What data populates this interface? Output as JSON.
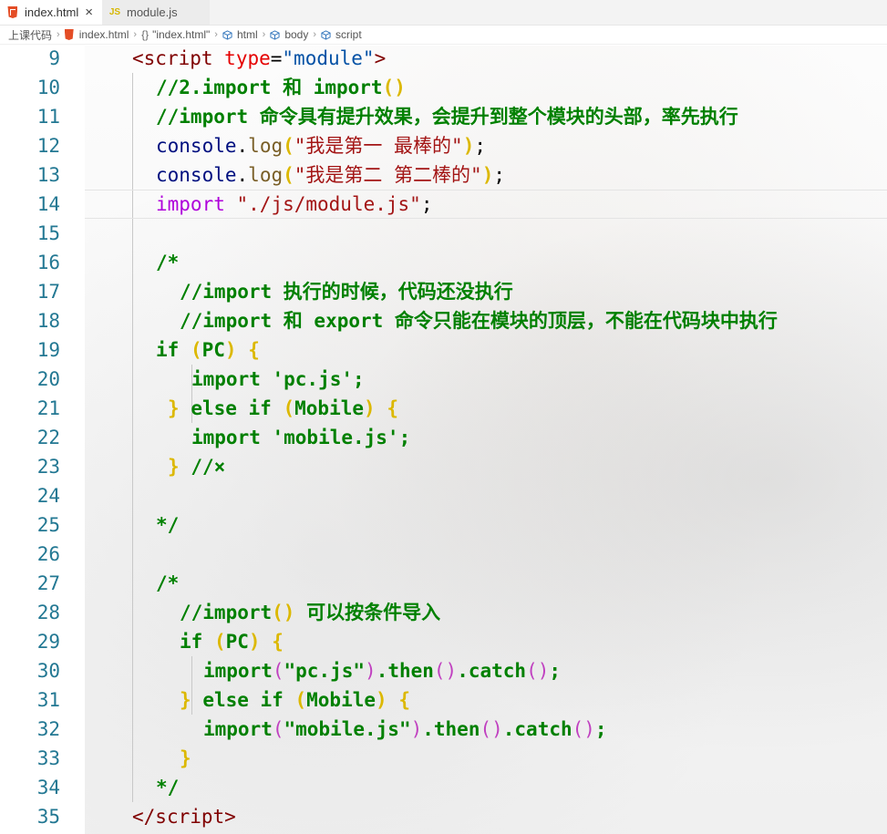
{
  "tabs": [
    {
      "label": "index.html",
      "active": true,
      "icon": "html5-icon"
    },
    {
      "label": "module.js",
      "active": false,
      "icon": "js-icon"
    }
  ],
  "breadcrumb": {
    "folder": "上课代码",
    "file": "index.html",
    "element": "\"index.html\"",
    "html": "html",
    "body": "body",
    "script": "script"
  },
  "editor": {
    "line_numbers": [
      "9",
      "10",
      "11",
      "12",
      "13",
      "14",
      "15",
      "16",
      "17",
      "18",
      "19",
      "20",
      "21",
      "22",
      "23",
      "24",
      "25",
      "26",
      "27",
      "28",
      "29",
      "30",
      "31",
      "32",
      "33",
      "34",
      "35"
    ],
    "current_line": "14",
    "code": {
      "l9": {
        "open": "<",
        "tag": "script",
        "attr": "type",
        "eq": "=",
        "val": "\"module\"",
        "close": ">"
      },
      "l10": {
        "text": "//2.import 和 import",
        "paren": "()"
      },
      "l11": {
        "text": "//import 命令具有提升效果，会提升到整个模块的头部，率先执行"
      },
      "l12": {
        "obj": "console",
        "dot": ".",
        "fn": "log",
        "lp": "(",
        "str": "\"我是第一 最棒的\"",
        "rp": ")",
        "semi": ";"
      },
      "l13": {
        "obj": "console",
        "dot": ".",
        "fn": "log",
        "lp": "(",
        "str": "\"我是第二 第二棒的\"",
        "rp": ")",
        "semi": ";"
      },
      "l14": {
        "kw": "import",
        "str": "\"./js/module.js\"",
        "semi": ";"
      },
      "l16": {
        "text": "/*"
      },
      "l17": {
        "text": "//import 执行的时候，代码还没执行"
      },
      "l18": {
        "text": "//import 和 export 命令只能在模块的顶层，不能在代码块中执行"
      },
      "l19": {
        "kw": "if",
        "lp": "(",
        "text": "PC",
        "rp": ")",
        "brace": "{"
      },
      "l20": {
        "text": "import 'pc.js';"
      },
      "l21": {
        "brace1": "}",
        "kw": "else if",
        "lp": "(",
        "text": "Mobile",
        "rp": ")",
        "brace2": "{"
      },
      "l22": {
        "text": "import 'mobile.js';"
      },
      "l23": {
        "brace": "}",
        "text": "//×"
      },
      "l25": {
        "text": "*/"
      },
      "l27": {
        "text": "/*"
      },
      "l28": {
        "text": "//import",
        "paren": "()",
        "rest": "可以按条件导入"
      },
      "l29": {
        "kw": "if",
        "lp": "(",
        "text": "PC",
        "rp": ")",
        "brace": "{"
      },
      "l30": {
        "a": "import",
        "lp": "(",
        "b": "\"pc.js\"",
        "rp": ")",
        "c": ".then",
        "p": "()",
        "d": ".catch",
        "p2": "()",
        "semi": ";"
      },
      "l31": {
        "brace1": "}",
        "kw": "else if",
        "lp": "(",
        "text": "Mobile",
        "rp": ")",
        "brace2": "{"
      },
      "l32": {
        "a": "import",
        "lp": "(",
        "b": "\"mobile.js\"",
        "rp": ")",
        "c": ".then",
        "p": "()",
        "d": ".catch",
        "p2": "()",
        "semi": ";"
      },
      "l33": {
        "brace": "}"
      },
      "l34": {
        "text": "*/"
      },
      "l35": {
        "open": "</",
        "tag": "script",
        "close": ">"
      }
    }
  },
  "colors": {
    "line_number": "#237893",
    "comment": "#008000",
    "bracket_gold": "#dcb800",
    "bracket_purple": "#c040c0",
    "tag": "#800000",
    "attribute": "#e50000",
    "string": "#0451a5",
    "keyword": "#af00db"
  }
}
